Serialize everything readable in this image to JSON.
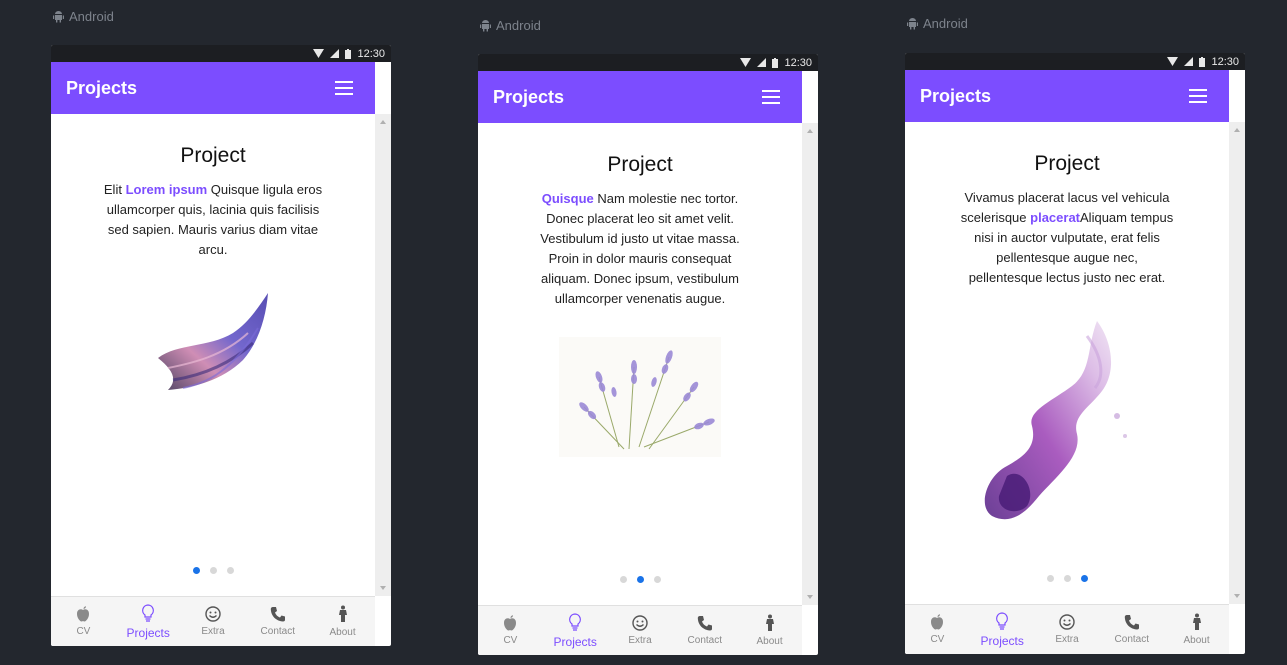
{
  "platform_label": "Android",
  "status_time": "12:30",
  "app_title": "Projects",
  "nav": [
    {
      "label": "CV",
      "icon": "apple-icon"
    },
    {
      "label": "Projects",
      "icon": "lightbulb-icon"
    },
    {
      "label": "Extra",
      "icon": "smiley-icon"
    },
    {
      "label": "Contact",
      "icon": "phone-icon"
    },
    {
      "label": "About",
      "icon": "person-icon"
    }
  ],
  "accent_color": "#7c4dff",
  "screens": [
    {
      "title": "Project",
      "desc_before": "Elit ",
      "desc_highlight": "Lorem ipsum",
      "desc_after": " Quisque ligula eros ullamcorper quis, lacinia quis facilisis sed sapien. Mauris varius diam vitae arcu.",
      "image": "purple-feather-wing",
      "active_dot": 1,
      "total_dots": 3
    },
    {
      "title": "Project",
      "desc_before": "",
      "desc_highlight": "Quisque",
      "desc_after": " Nam molestie nec tortor. Donec placerat leo sit amet velit. Vestibulum id justo ut vitae massa. Proin in dolor mauris consequat aliquam. Donec ipsum, vestibulum ullamcorper venenatis augue.",
      "image": "lavender-flowers",
      "active_dot": 2,
      "total_dots": 3
    },
    {
      "title": "Project",
      "desc_before": "Vivamus placerat lacus vel vehicula scelerisque ",
      "desc_highlight": "placerat",
      "desc_after": "Aliquam tempus nisi in auctor vulputate, erat felis pellentesque augue nec, pellentesque lectus justo nec erat.",
      "image": "purple-watercolor-splash",
      "active_dot": 3,
      "total_dots": 3
    }
  ]
}
